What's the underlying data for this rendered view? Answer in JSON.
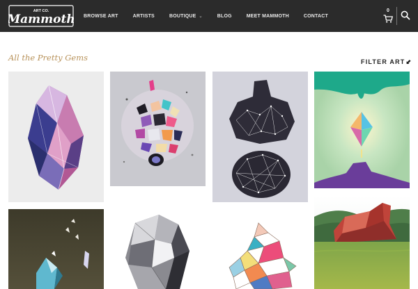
{
  "brand": {
    "top": "ART CO.",
    "name": "Mammoth"
  },
  "nav": {
    "items": [
      {
        "label": "BROWSE ART"
      },
      {
        "label": "ARTISTS"
      },
      {
        "label": "BOUTIQUE",
        "has_dropdown": true
      },
      {
        "label": "BLOG"
      },
      {
        "label": "MEET MAMMOTH"
      },
      {
        "label": "CONTACT"
      }
    ],
    "cart_count": "0",
    "cart_icon": "cart-icon",
    "search_icon": "search-icon",
    "dropdown_icon": "chevron-down-icon"
  },
  "main": {
    "title": "All the Pretty Gems",
    "filter_label": "FILTER ART",
    "filter_icon": "corner-arrow-icon"
  },
  "colors": {
    "topbar": "#2b2b2b",
    "nav_text": "#e8e8e8",
    "title_gold": "#b8925a",
    "page_bg": "#ffffff"
  },
  "gallery": [
    {
      "name": "crystal-gem-painting"
    },
    {
      "name": "confetti-gems-painting"
    },
    {
      "name": "constellation-rocks-painting"
    },
    {
      "name": "glowing-diamond-painting"
    },
    {
      "name": "dark-crystal-painting"
    },
    {
      "name": "grey-crystal-painting"
    },
    {
      "name": "geometric-triangles-painting"
    },
    {
      "name": "red-rock-landscape-painting"
    }
  ]
}
